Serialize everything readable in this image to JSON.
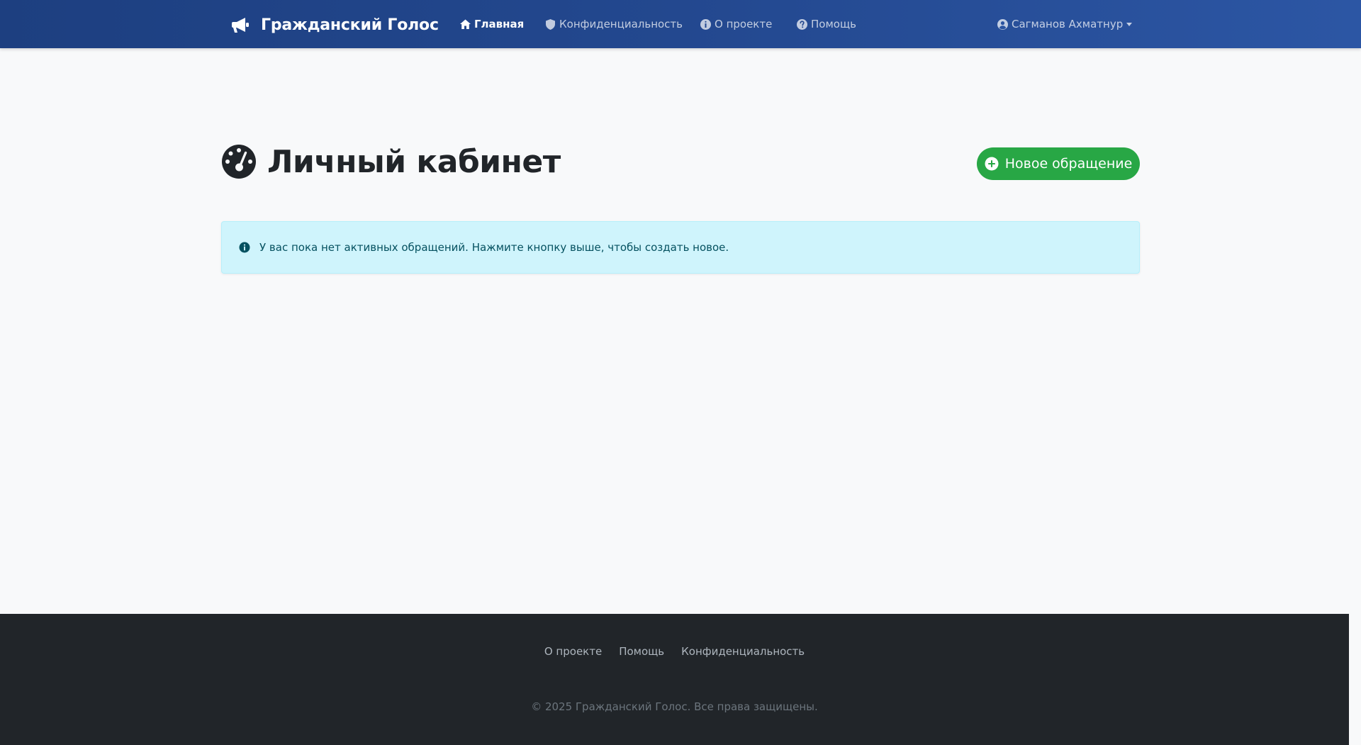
{
  "navbar": {
    "brand": "Гражданский Голос",
    "brand_icon": "megaphone-icon",
    "items": [
      {
        "label": "Главная",
        "icon": "home-icon",
        "active": true
      },
      {
        "label": "Конфиденциальность",
        "icon": "shield-icon",
        "active": false
      },
      {
        "label": "О проекте",
        "icon": "info-circle-icon",
        "active": false
      },
      {
        "label": "Помощь",
        "icon": "question-circle-icon",
        "active": false
      }
    ],
    "user": {
      "name": "Сагманов Ахматнур",
      "icon": "user-circle-icon"
    }
  },
  "main": {
    "title": "Личный кабинет",
    "title_icon": "dashboard-gauge-icon",
    "new_button_label": "Новое обращение",
    "new_button_icon": "plus-circle-icon",
    "alert_text": "У вас пока нет активных обращений. Нажмите кнопку выше, чтобы создать новое.",
    "alert_icon": "info-circle-icon"
  },
  "footer": {
    "links": [
      "О проекте",
      "Помощь",
      "Конфиденциальность"
    ],
    "copyright": "© 2025 Гражданский Голос. Все права защищены."
  },
  "colors": {
    "navbar_start": "#1d3f80",
    "navbar_end": "#2c56a4",
    "button_green": "#28a745",
    "alert_bg": "#cff4fc",
    "alert_text": "#055160",
    "footer_bg": "#212529",
    "page_bg": "#f8f9fa"
  }
}
